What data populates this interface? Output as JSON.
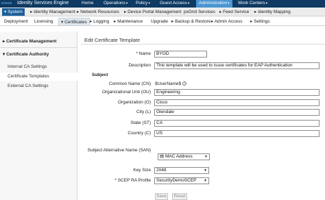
{
  "header": {
    "brand_logo": "cisco",
    "brand_title": "Identity Services Engine",
    "menu": [
      {
        "label": "Home"
      },
      {
        "label": "Operations"
      },
      {
        "label": "Policy"
      },
      {
        "label": "Guest Access"
      },
      {
        "label": "Administration"
      },
      {
        "label": "Work Centers"
      }
    ]
  },
  "nav2": {
    "items": [
      {
        "label": "System"
      },
      {
        "label": "Identity Management"
      },
      {
        "label": "Network Resources"
      },
      {
        "label": "Device Portal Management"
      },
      {
        "label": "pxGrid Services"
      },
      {
        "label": "Feed Service"
      },
      {
        "label": "Identity Mapping"
      }
    ]
  },
  "nav3": {
    "items": [
      {
        "label": "Deployment"
      },
      {
        "label": "Licensing"
      },
      {
        "label": "Certificates"
      },
      {
        "label": "Logging"
      },
      {
        "label": "Maintenance"
      },
      {
        "label": "Upgrade"
      },
      {
        "label": "Backup & Restore"
      },
      {
        "label": "Admin Access"
      },
      {
        "label": "Settings"
      }
    ]
  },
  "sidebar": {
    "sections": [
      {
        "label": "Certificate Management"
      },
      {
        "label": "Certificate Authority"
      }
    ],
    "items": [
      {
        "label": "Internal CA Settings"
      },
      {
        "label": "Certificate Templates"
      },
      {
        "label": "External CA Settings"
      }
    ]
  },
  "form": {
    "title": "Edit Certificate Template",
    "name_label": "* Name",
    "name_value": "BYOD",
    "description_label": "Description",
    "description_value": "This template will be used to issue certificates for EAP Authentication",
    "subject_heading": "Subject",
    "cn_label": "Common Name (CN)",
    "cn_value": "$UserName$",
    "ou_label": "Organizational Unit (OU)",
    "ou_value": "Engineering",
    "o_label": "Organization (O)",
    "o_value": "Cisco",
    "l_label": "City (L)",
    "l_value": "Glendale",
    "st_label": "State (ST)",
    "st_value": "CA",
    "c_label": "Country (C)",
    "c_value": "US",
    "san_label": "Subject Alternative Name (SAN)",
    "san_value": "MAC Address",
    "keysize_label": "Key Size",
    "keysize_value": "2048",
    "scep_label": "* SCEP RA Profile",
    "scep_value": "SecurityDemoSCEP",
    "save_label": "Save",
    "reset_label": "Reset"
  },
  "icons": {
    "dropdown": "chevron-down-icon",
    "info": "info-icon",
    "list": "list-icon"
  }
}
